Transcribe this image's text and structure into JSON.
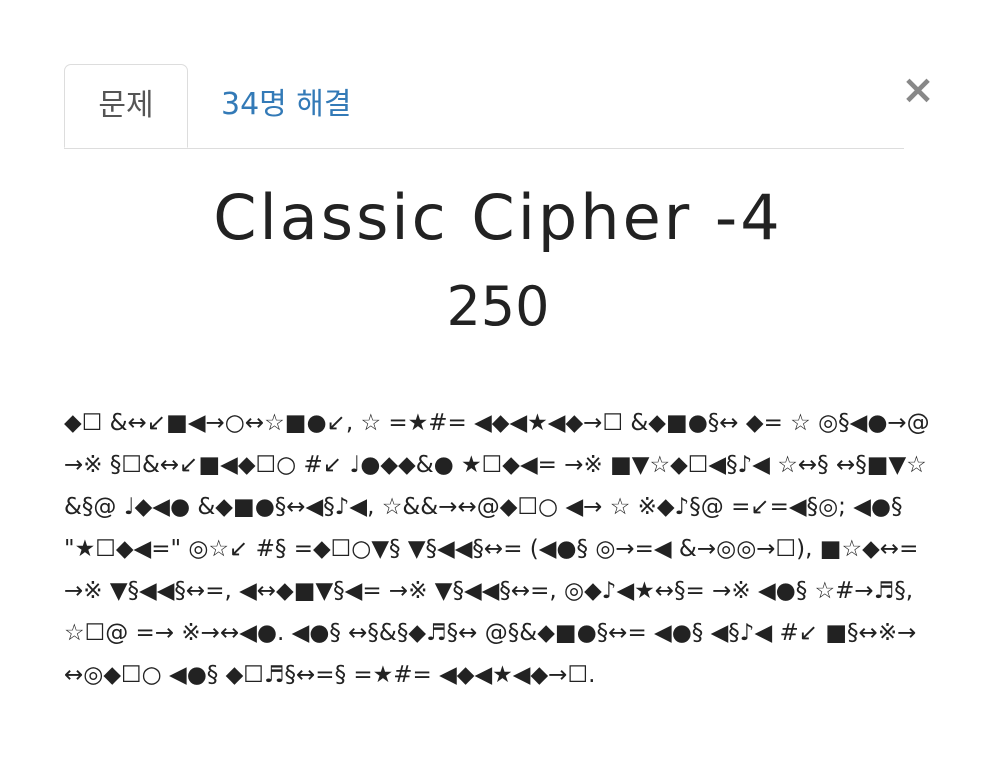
{
  "tabs": {
    "challenge_label": "문제",
    "solves_label": "34명 해결"
  },
  "close": {
    "label": "×"
  },
  "challenge": {
    "name": "Classic Cipher -4",
    "value": "250",
    "description": "◆☐ &↔↙■◀→○↔☆■●↙, ☆ =★#= ◀◆◀★◀◆→☐ &◆■●§↔ ◆= ☆ ◎§◀●→@→※ §☐&↔↙■◀◆☐○ #↙ ♩●◆◆&● ★☐◆◀= →※ ■▼☆◆☐◀§♪◀ ☆↔§ ↔§■▼☆&§@ ♩◆◀● &◆■●§↔◀§♪◀, ☆&&→↔@◆☐○ ◀→ ☆ ※◆♪§@ =↙=◀§◎; ◀●§ \"★☐◆◀=\" ◎☆↙ #§ =◆☐○▼§ ▼§◀◀§↔= (◀●§ ◎→=◀ &→◎◎→☐), ■☆◆↔= →※ ▼§◀◀§↔=, ◀↔◆■▼§◀= →※ ▼§◀◀§↔=, ◎◆♪◀★↔§= →※ ◀●§ ☆#→♬§, ☆☐@ =→ ※→↔◀●. ◀●§ ↔§&§◆♬§↔ @§&◆■●§↔= ◀●§ ◀§♪◀ #↙ ■§↔※→↔◎◆☐○ ◀●§ ◆☐♬§↔=§ =★#= ◀◆◀★◀◆→☐."
  }
}
